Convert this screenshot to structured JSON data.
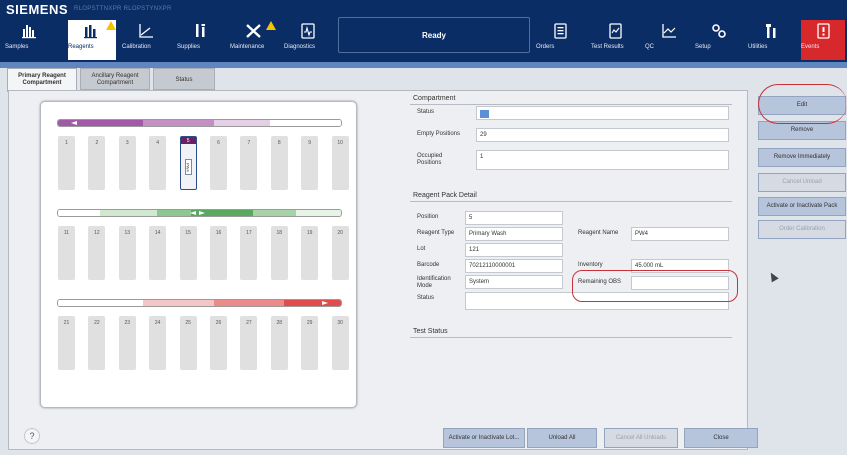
{
  "header": {
    "brand": "SIEMENS",
    "sub": "RLOPSTTNXPR RLOPSTYNXPR",
    "status": "Ready",
    "nav_left": [
      {
        "label": "Samples",
        "icon": "bar-chart-icon"
      },
      {
        "label": "Reagents",
        "icon": "reagent-icon",
        "active": true,
        "warn": true
      },
      {
        "label": "Calibration",
        "icon": "calibration-icon"
      },
      {
        "label": "Supplies",
        "icon": "supplies-icon"
      },
      {
        "label": "Maintenance",
        "icon": "tools-icon",
        "warn": true
      },
      {
        "label": "Diagnostics",
        "icon": "diagnostics-icon"
      }
    ],
    "nav_right": [
      {
        "label": "Orders",
        "icon": "orders-icon"
      },
      {
        "label": "Test Results",
        "icon": "results-icon"
      },
      {
        "label": "QC",
        "icon": "qc-chart-icon"
      },
      {
        "label": "Setup",
        "icon": "setup-icon"
      },
      {
        "label": "Utilities",
        "icon": "utilities-icon"
      },
      {
        "label": "Events",
        "icon": "events-icon",
        "alert": true
      }
    ]
  },
  "tabs": [
    {
      "label": "Primary Reagent Compartment",
      "active": true
    },
    {
      "label": "Ancillary Reagent Compartment"
    },
    {
      "label": "Status"
    }
  ],
  "compartment_rows": [
    {
      "positions": [
        "1",
        "2",
        "3",
        "4",
        "5",
        "6",
        "7",
        "8",
        "9",
        "10"
      ],
      "color": "#a25aa8"
    },
    {
      "positions": [
        "11",
        "12",
        "13",
        "14",
        "15",
        "16",
        "17",
        "18",
        "19",
        "20"
      ],
      "color": "#58a85f"
    },
    {
      "positions": [
        "21",
        "22",
        "23",
        "24",
        "25",
        "26",
        "27",
        "28",
        "29",
        "30"
      ],
      "color": "#e04c4c"
    }
  ],
  "selected_pack": {
    "position": "5",
    "name": "PW4"
  },
  "compartment": {
    "title": "Compartment",
    "status_label": "Status",
    "empty_label": "Empty Positions",
    "empty_value": "29",
    "occupied_label": "Occupied Positions",
    "occupied_value": "1"
  },
  "detail": {
    "title": "Reagent Pack Detail",
    "position_label": "Position",
    "position_value": "5",
    "type_label": "Reagent Type",
    "type_value": "Primary Wash",
    "name_label": "Reagent Name",
    "name_value": "PW4",
    "lot_label": "Lot",
    "lot_value": "121",
    "barcode_label": "Barcode",
    "barcode_value": "70212110000001",
    "inventory_label": "Inventory",
    "inventory_value": "45.000 mL",
    "idmode_label": "Identification Mode",
    "idmode_value": "System",
    "obs_label": "Remaining OBS",
    "obs_value": "",
    "status_label": "Status",
    "status_value": ""
  },
  "test_status": {
    "title": "Test Status"
  },
  "actions": {
    "edit": "Edit",
    "remove": "Remove",
    "remove_immediately": "Remove Immediately",
    "cancel_unload": "Cancel Unload",
    "activate_pack": "Activate or Inactivate Pack",
    "order_calibration": "Order Calibration"
  },
  "bottom": {
    "activate_lot": "Activate or Inactivate Lot...",
    "unload_all": "Unload All",
    "cancel_all": "Cancel All Unloads",
    "close": "Close",
    "help": "?"
  },
  "colors": {
    "header": "#0b2d66",
    "accent": "#5f86bf",
    "alert": "#d7282c",
    "callout": "#c9313a"
  }
}
